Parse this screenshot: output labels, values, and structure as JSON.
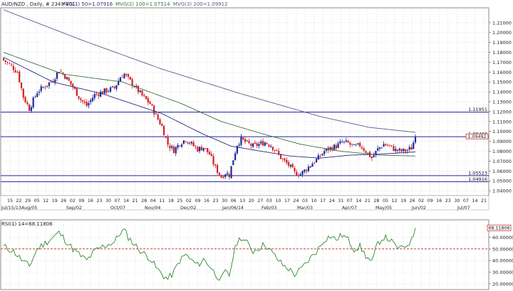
{
  "header": {
    "legend": [
      "AUD/NZD , Daily, # 234 / 801",
      "MVG(1) 50=1.07916",
      "MVG(2) 100=1.07514",
      "MVG(3) 200=1.09912"
    ]
  },
  "colors": {
    "background": "#ffffff",
    "panel_border": "#888888",
    "grid": "#cfcfcf",
    "bull": "#1a2a9a",
    "bear": "#d42020",
    "level": "#2222aa",
    "ma50": "#2a2a7a",
    "ma100": "#3f6e3f",
    "ma200": "#5a5a8a",
    "rsi": "#2f8a2f",
    "rsi_mid": "#cc2222",
    "tag_border": "#cc3333",
    "tag_fill": "#ffffff"
  },
  "chart_data": [
    {
      "type": "candlestick",
      "symbol": "AUD/NZD",
      "timeframe": "Daily",
      "ylim": [
        1.035,
        1.225
      ],
      "yticks": [
        "1.21000",
        "1.20000",
        "1.19000",
        "1.18000",
        "1.17000",
        "1.16000",
        "1.15000",
        "1.14000",
        "1.13000",
        "1.12000",
        "1.11000",
        "1.10000",
        "1.09000",
        "1.08000",
        "1.07000",
        "1.06000",
        "1.05000",
        "1.04000"
      ],
      "xticks": [
        "15",
        "22",
        "29",
        "05",
        "12",
        "19",
        "26",
        "02",
        "09",
        "16",
        "23",
        "30",
        "07",
        "14",
        "21",
        "28",
        "04",
        "11",
        "18",
        "25",
        "02",
        "09",
        "16",
        "23",
        "30",
        "06",
        "13",
        "20",
        "27",
        "03",
        "10",
        "17",
        "24",
        "03",
        "10",
        "17",
        "24",
        "31",
        "07",
        "14",
        "21",
        "28",
        "05",
        "12",
        "19",
        "26",
        "02",
        "09",
        "16",
        "23",
        "30",
        "07",
        "14",
        "21"
      ],
      "month_labels": [
        "Jul/15/13",
        "Aug/05",
        "Sep/02",
        "Oct/07",
        "Nov/04",
        "Dec/02",
        "Jan/06/14",
        "Feb/03",
        "Mar/03",
        "Apr/07",
        "May/05",
        "Jun/02",
        "Jul/07"
      ],
      "levels": [
        {
          "label": "1.11951",
          "value": 1.11951
        },
        {
          "label": "1.09468",
          "value": 1.09468
        },
        {
          "label": "1.05523",
          "value": 1.05523
        },
        {
          "label": "1.04916",
          "value": 1.04916
        }
      ],
      "last_price": {
        "label": "1.09492",
        "value": 1.09492
      },
      "series_indicators": [
        {
          "name": "MVG(1) 50",
          "value": 1.07916
        },
        {
          "name": "MVG(2) 100",
          "value": 1.07514
        },
        {
          "name": "MVG(3) 200",
          "value": 1.09912
        }
      ],
      "anchors_close": [
        [
          0,
          1.172
        ],
        [
          4,
          1.166
        ],
        [
          7,
          1.16
        ],
        [
          10,
          1.135
        ],
        [
          13,
          1.123
        ],
        [
          17,
          1.14
        ],
        [
          21,
          1.146
        ],
        [
          25,
          1.152
        ],
        [
          28,
          1.162
        ],
        [
          31,
          1.156
        ],
        [
          35,
          1.145
        ],
        [
          39,
          1.132
        ],
        [
          42,
          1.126
        ],
        [
          46,
          1.137
        ],
        [
          50,
          1.14
        ],
        [
          53,
          1.142
        ],
        [
          56,
          1.144
        ],
        [
          59,
          1.155
        ],
        [
          61,
          1.158
        ],
        [
          63,
          1.153
        ],
        [
          66,
          1.146
        ],
        [
          70,
          1.136
        ],
        [
          74,
          1.128
        ],
        [
          77,
          1.116
        ],
        [
          80,
          1.105
        ],
        [
          83,
          1.087
        ],
        [
          86,
          1.081
        ],
        [
          89,
          1.088
        ],
        [
          92,
          1.092
        ],
        [
          95,
          1.087
        ],
        [
          98,
          1.082
        ],
        [
          101,
          1.084
        ],
        [
          104,
          1.077
        ],
        [
          107,
          1.063
        ],
        [
          110,
          1.054
        ],
        [
          112,
          1.058
        ],
        [
          114,
          1.056
        ],
        [
          116,
          1.072
        ],
        [
          118,
          1.087
        ],
        [
          120,
          1.092
        ],
        [
          123,
          1.088
        ],
        [
          126,
          1.085
        ],
        [
          129,
          1.087
        ],
        [
          132,
          1.089
        ],
        [
          135,
          1.086
        ],
        [
          138,
          1.079
        ],
        [
          141,
          1.071
        ],
        [
          144,
          1.066
        ],
        [
          147,
          1.058
        ],
        [
          150,
          1.057
        ],
        [
          153,
          1.062
        ],
        [
          156,
          1.068
        ],
        [
          159,
          1.073
        ],
        [
          162,
          1.08
        ],
        [
          165,
          1.083
        ],
        [
          168,
          1.085
        ],
        [
          171,
          1.089
        ],
        [
          174,
          1.088
        ],
        [
          177,
          1.084
        ],
        [
          180,
          1.086
        ],
        [
          183,
          1.08
        ],
        [
          186,
          1.073
        ],
        [
          189,
          1.082
        ],
        [
          192,
          1.087
        ],
        [
          195,
          1.085
        ],
        [
          198,
          1.081
        ],
        [
          201,
          1.08
        ],
        [
          204,
          1.081
        ],
        [
          206,
          1.083
        ],
        [
          208,
          1.0949
        ]
      ],
      "ma50": [
        [
          0,
          1.175
        ],
        [
          25,
          1.15
        ],
        [
          50,
          1.138
        ],
        [
          80,
          1.118
        ],
        [
          100,
          1.098
        ],
        [
          115,
          1.085
        ],
        [
          130,
          1.08
        ],
        [
          145,
          1.075
        ],
        [
          160,
          1.073
        ],
        [
          175,
          1.076
        ],
        [
          190,
          1.077
        ],
        [
          208,
          1.0792
        ]
      ],
      "ma100": [
        [
          0,
          1.18
        ],
        [
          30,
          1.158
        ],
        [
          60,
          1.15
        ],
        [
          90,
          1.128
        ],
        [
          110,
          1.11
        ],
        [
          130,
          1.098
        ],
        [
          150,
          1.087
        ],
        [
          170,
          1.08
        ],
        [
          190,
          1.076
        ],
        [
          208,
          1.0751
        ]
      ],
      "ma200": [
        [
          0,
          1.223
        ],
        [
          40,
          1.192
        ],
        [
          80,
          1.163
        ],
        [
          120,
          1.138
        ],
        [
          160,
          1.115
        ],
        [
          185,
          1.104
        ],
        [
          208,
          1.0991
        ]
      ]
    },
    {
      "type": "line",
      "name": "RSI(1) 14",
      "current_label": "RSI(1) 14=68.11806",
      "current_value": 68.11806,
      "value_tag": "68.11806",
      "ylim": [
        15,
        75
      ],
      "yticks": [
        "60.00000",
        "50.00000",
        "40.00000",
        "30.00000",
        "20.00000"
      ],
      "midline": 50,
      "anchors": [
        [
          0,
          52
        ],
        [
          5,
          48
        ],
        [
          10,
          39
        ],
        [
          13,
          35
        ],
        [
          17,
          50
        ],
        [
          21,
          55
        ],
        [
          25,
          60
        ],
        [
          28,
          64
        ],
        [
          31,
          58
        ],
        [
          35,
          50
        ],
        [
          39,
          44
        ],
        [
          42,
          40
        ],
        [
          46,
          48
        ],
        [
          50,
          52
        ],
        [
          53,
          54
        ],
        [
          56,
          56
        ],
        [
          59,
          64
        ],
        [
          61,
          66
        ],
        [
          63,
          60
        ],
        [
          66,
          54
        ],
        [
          70,
          47
        ],
        [
          74,
          42
        ],
        [
          77,
          34
        ],
        [
          80,
          28
        ],
        [
          83,
          24
        ],
        [
          86,
          30
        ],
        [
          89,
          40
        ],
        [
          92,
          45
        ],
        [
          95,
          40
        ],
        [
          98,
          36
        ],
        [
          101,
          41
        ],
        [
          104,
          36
        ],
        [
          107,
          28
        ],
        [
          110,
          24
        ],
        [
          112,
          30
        ],
        [
          114,
          27
        ],
        [
          116,
          44
        ],
        [
          118,
          56
        ],
        [
          120,
          60
        ],
        [
          123,
          55
        ],
        [
          126,
          48
        ],
        [
          129,
          51
        ],
        [
          132,
          54
        ],
        [
          135,
          48
        ],
        [
          138,
          42
        ],
        [
          141,
          36
        ],
        [
          144,
          33
        ],
        [
          147,
          28
        ],
        [
          150,
          32
        ],
        [
          153,
          38
        ],
        [
          156,
          44
        ],
        [
          159,
          50
        ],
        [
          162,
          58
        ],
        [
          165,
          61
        ],
        [
          168,
          58
        ],
        [
          171,
          62
        ],
        [
          174,
          58
        ],
        [
          177,
          50
        ],
        [
          180,
          52
        ],
        [
          183,
          44
        ],
        [
          186,
          38
        ],
        [
          189,
          55
        ],
        [
          192,
          60
        ],
        [
          195,
          58
        ],
        [
          198,
          52
        ],
        [
          201,
          50
        ],
        [
          204,
          54
        ],
        [
          206,
          57
        ],
        [
          208,
          68.1
        ]
      ]
    }
  ]
}
